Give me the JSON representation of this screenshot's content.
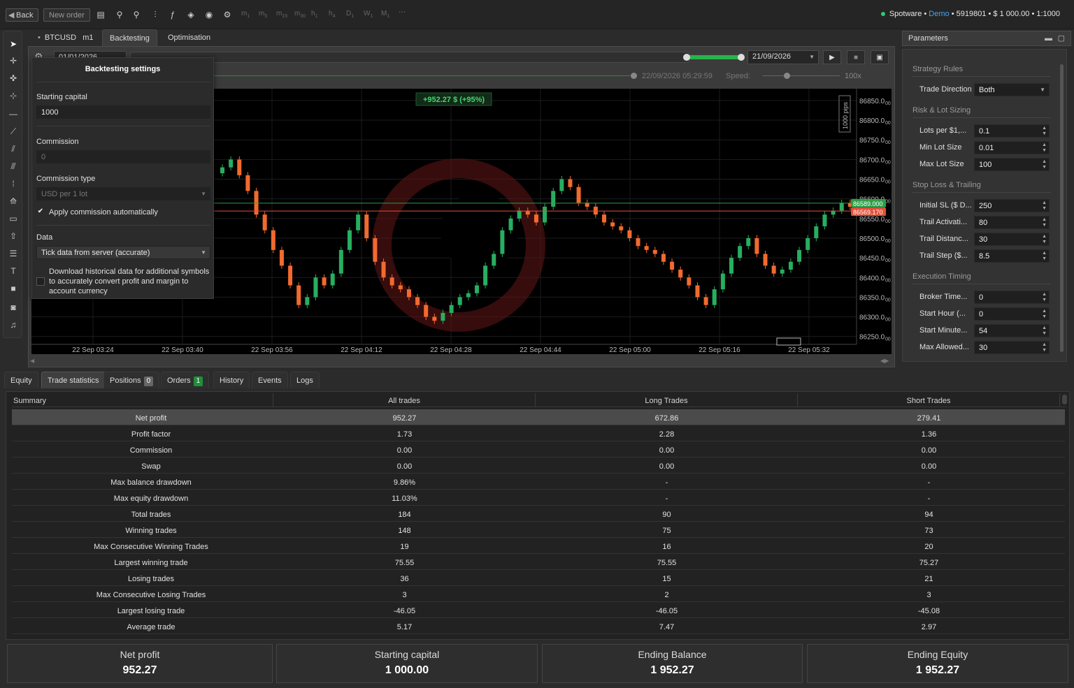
{
  "topbar": {
    "back": "Back",
    "new_order": "New order",
    "timeframes": [
      {
        "base": "m",
        "sub": "1"
      },
      {
        "base": "m",
        "sub": "5"
      },
      {
        "base": "m",
        "sub": "15"
      },
      {
        "base": "m",
        "sub": "30"
      },
      {
        "base": "h",
        "sub": "1"
      },
      {
        "base": "h",
        "sub": "4"
      },
      {
        "base": "D",
        "sub": "1"
      },
      {
        "base": "W",
        "sub": "1"
      },
      {
        "base": "M",
        "sub": "1"
      }
    ],
    "more": "⋯",
    "broker": "Spotware",
    "account_type": "Demo",
    "account_info": " • 5919801 • $ 1 000.00 • 1:1000"
  },
  "symbol_tabs": {
    "symbol": "BTCUSD",
    "timeframe": "m1",
    "backtesting": "Backtesting",
    "optimisation": "Optimisation"
  },
  "chartbar": {
    "start_date": "01/01/2026",
    "end_date": "21/09/2026",
    "progress_time": "22/09/2026 05:29:59",
    "speed_label": "Speed:",
    "speed_value": "100x"
  },
  "chart": {
    "pnl_label": "+952.27 $ (+95%)",
    "scale_label": "1000 pips",
    "price_ticks": [
      "86850.0",
      "86800.0",
      "86750.0",
      "86700.0",
      "86650.0",
      "86600.0",
      "86550.0",
      "86500.0",
      "86450.0",
      "86400.0",
      "86350.0",
      "86300.0",
      "86250.0"
    ],
    "price_tick_suffix": "00",
    "time_ticks": [
      "22 Sep 03:24",
      "22 Sep 03:40",
      "22 Sep 03:56",
      "22 Sep 04:12",
      "22 Sep 04:28",
      "22 Sep 04:44",
      "22 Sep 05:00",
      "22 Sep 05:16",
      "22 Sep 05:32"
    ],
    "ask_label": "86589.000",
    "bid_label": "86569.170",
    "colors": {
      "up": "#27ae60",
      "down": "#f26a2e",
      "ask": "#2e9e47",
      "bid": "#e2513a"
    }
  },
  "chart_data": {
    "type": "candlestick",
    "y_range": [
      86230,
      86880
    ],
    "note_series": "BTCUSD m1 close approximations",
    "closes": [
      86680,
      86700,
      86660,
      86620,
      86560,
      86520,
      86470,
      86430,
      86380,
      86330,
      86350,
      86400,
      86380,
      86410,
      86470,
      86520,
      86560,
      86500,
      86440,
      86400,
      86380,
      86370,
      86350,
      86330,
      86300,
      86290,
      86310,
      86330,
      86350,
      86360,
      86380,
      86430,
      86460,
      86520,
      86550,
      86570,
      86560,
      86540,
      86580,
      86620,
      86650,
      86630,
      86590,
      86580,
      86560,
      86540,
      86530,
      86520,
      86500,
      86480,
      86470,
      86460,
      86440,
      86420,
      86400,
      86380,
      86350,
      86330,
      86370,
      86410,
      86450,
      86480,
      86500,
      86460,
      86430,
      86410,
      86420,
      86440,
      86470,
      86500,
      86530,
      86560,
      86570,
      86590,
      86580
    ]
  },
  "settings": {
    "title": "Backtesting settings",
    "starting_capital_label": "Starting capital",
    "starting_capital": "1000",
    "commission_label": "Commission",
    "commission": "0",
    "commission_type_label": "Commission type",
    "commission_type": "USD per 1 lot",
    "apply_auto": "Apply commission automatically",
    "data_label": "Data",
    "data_value": "Tick data from server (accurate)",
    "download_text": "Download historical data for additional symbols to accurately convert profit and margin to account currency"
  },
  "params": {
    "header": "Parameters",
    "groups": [
      {
        "title": "Strategy Rules",
        "items": [
          {
            "label": "Trade Direction",
            "value": "Both",
            "kind": "select"
          }
        ]
      },
      {
        "title": "Risk & Lot Sizing",
        "items": [
          {
            "label": "Lots per $1,...",
            "value": "0.1",
            "kind": "spin"
          },
          {
            "label": "Min Lot Size",
            "value": "0.01",
            "kind": "spin"
          },
          {
            "label": "Max Lot Size",
            "value": "100",
            "kind": "spin"
          }
        ]
      },
      {
        "title": "Stop Loss & Trailing",
        "items": [
          {
            "label": "Initial SL ($ D...",
            "value": "250",
            "kind": "spin"
          },
          {
            "label": "Trail Activati...",
            "value": "80",
            "kind": "spin"
          },
          {
            "label": "Trail Distanc...",
            "value": "30",
            "kind": "spin"
          },
          {
            "label": "Trail Step ($...",
            "value": "8.5",
            "kind": "spin"
          }
        ]
      },
      {
        "title": "Execution Timing",
        "items": [
          {
            "label": "Broker Time...",
            "value": "0",
            "kind": "spin"
          },
          {
            "label": "Start Hour (...",
            "value": "0",
            "kind": "spin"
          },
          {
            "label": "Start Minute...",
            "value": "54",
            "kind": "spin"
          },
          {
            "label": "Max Allowed...",
            "value": "30",
            "kind": "spin"
          }
        ]
      }
    ]
  },
  "panel_tabs": {
    "equity": "Equity",
    "trade_stats": "Trade statistics",
    "positions": "Positions",
    "positions_count": "0",
    "orders": "Orders",
    "orders_count": "1",
    "history": "History",
    "events": "Events",
    "logs": "Logs"
  },
  "stats": {
    "headers": [
      "Summary",
      "All trades",
      "Long Trades",
      "Short Trades"
    ],
    "rows": [
      [
        "Net profit",
        "952.27",
        "672.86",
        "279.41"
      ],
      [
        "Profit factor",
        "1.73",
        "2.28",
        "1.36"
      ],
      [
        "Commission",
        "0.00",
        "0.00",
        "0.00"
      ],
      [
        "Swap",
        "0.00",
        "0.00",
        "0.00"
      ],
      [
        "Max balance drawdown",
        "9.86%",
        "-",
        "-"
      ],
      [
        "Max equity drawdown",
        "11.03%",
        "-",
        "-"
      ],
      [
        "Total trades",
        "184",
        "90",
        "94"
      ],
      [
        "Winning trades",
        "148",
        "75",
        "73"
      ],
      [
        "Max Consecutive Winning Trades",
        "19",
        "16",
        "20"
      ],
      [
        "Largest winning trade",
        "75.55",
        "75.55",
        "75.27"
      ],
      [
        "Losing trades",
        "36",
        "15",
        "21"
      ],
      [
        "Max Consecutive Losing Trades",
        "3",
        "2",
        "3"
      ],
      [
        "Largest losing trade",
        "-46.05",
        "-46.05",
        "-45.08"
      ],
      [
        "Average trade",
        "5.17",
        "7.47",
        "2.97"
      ]
    ]
  },
  "summary": [
    {
      "label": "Net profit",
      "value": "952.27"
    },
    {
      "label": "Starting capital",
      "value": "1 000.00"
    },
    {
      "label": "Ending Balance",
      "value": "1 952.27"
    },
    {
      "label": "Ending Equity",
      "value": "1 952.27"
    }
  ]
}
